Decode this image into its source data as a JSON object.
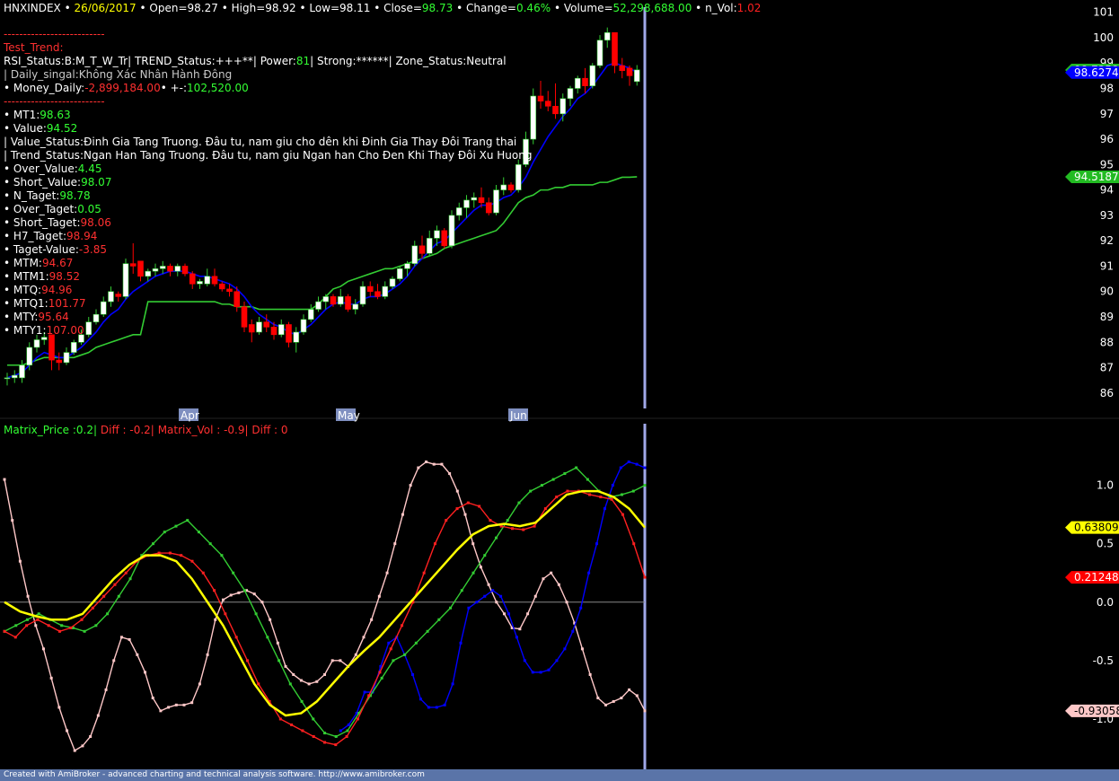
{
  "header": {
    "symbol": "HNXINDEX",
    "bullet": "•",
    "date": "26/06/2017",
    "open_label": "Open=",
    "open": "98.27",
    "high_label": "High=",
    "high": "98.92",
    "low_label": "Low=",
    "low": "98.11",
    "close_label": "Close=",
    "close": "98.73",
    "change_label": "Change=",
    "change": "0.46%",
    "volume_label": "Volume=",
    "volume": "52,298,688.00",
    "nvol_label": "n_Vol:",
    "nvol": "1.02"
  },
  "info": {
    "separator": "--------------------------",
    "test_trend": "Test_Trend:",
    "status_line": "RSI_Status:B:M_T_W_Tr| TREND_Status:+++**| Power:",
    "power": "81",
    "strong": "| Strong:******| Zone_Status:Neutral",
    "daily_signal": "| Daily_singal:Không Xác Nhân Hành Đông",
    "money_label": "• Money_Daily:",
    "money_value": "-2,899,184.00",
    "pm_label": "• +-:",
    "pm_value": "102,520.00",
    "mt1_label": "• MT1:",
    "mt1": "98.63",
    "value_label": "• Value:",
    "value": "94.52",
    "value_status": "| Value_Status:Đinh Gia Tang Truong. Đâu tu, nam giu cho dên khi Đinh Gia Thay Đôi Trang thai",
    "trend_status": "| Trend_Status:Ngan Han Tang Truong. Đâu tu, nam giu Ngan han Cho Đen Khi Thay Đôi Xu Huong",
    "over_value_label": "• Over_Value:",
    "over_value": "4.45",
    "short_value_label": "• Short_Value:",
    "short_value": "98.07",
    "n_taget_label": "• N_Taget:",
    "n_taget": "98.78",
    "over_taget_label": "• Over_Taget:",
    "over_taget": "0.05",
    "short_taget_label": "• Short_Taget:",
    "short_taget": "98.06",
    "h7_taget_label": "• H7_Taget:",
    "h7_taget": "98.94",
    "taget_value_label": "• Taget-Value:",
    "taget_value": "-3.85",
    "mtm_label": "• MTM:",
    "mtm": "94.67",
    "mtm1_label": "• MTM1:",
    "mtm1": "98.52",
    "mtq_label": "• MTQ:",
    "mtq": "94.96",
    "mtq1_label": "• MTQ1:",
    "mtq1": "101.77",
    "mty_label": "• MTY:",
    "mty": "95.64",
    "mty1_label": "• MTY1:",
    "mty1": "107.00"
  },
  "indicator": {
    "matrix_price": "Matrix_Price :0.2|",
    "diff1": "Diff : -0.2|",
    "matrix_vol": "Matrix_Vol : -0.9|",
    "diff2": "Diff : 0"
  },
  "footer": "Created with AmiBroker - advanced charting and technical analysis software. http://www.amibroker.com",
  "colors": {
    "up_candle": "#ffffff",
    "down_candle": "#ff0000",
    "green": "#33cc33",
    "blue": "#0000ff",
    "yellow": "#ffff00",
    "red": "#ff0000",
    "pink": "#ffc8c8",
    "cursor": "#a0a8e8",
    "month_tag": "#7f8fc0"
  },
  "chart_data": [
    {
      "type": "candlestick",
      "title": "HNXINDEX",
      "x_labels": [
        "Apr",
        "May",
        "Jun"
      ],
      "ylim": [
        85.5,
        101.2
      ],
      "y_ticks": [
        86,
        87,
        88,
        89,
        90,
        91,
        92,
        93,
        94,
        95,
        96,
        97,
        98,
        99,
        100,
        101
      ],
      "tags": [
        {
          "value": 98.7258,
          "label": "98.7258",
          "color": "#22bb22"
        },
        {
          "value": 98.6274,
          "label": "98.6274",
          "color": "#0000ff"
        },
        {
          "value": 94.5187,
          "label": "94.5187",
          "color": "#22bb22"
        }
      ],
      "ohlc": [
        [
          86.6,
          86.8,
          86.3,
          86.6
        ],
        [
          86.6,
          86.9,
          86.4,
          86.7
        ],
        [
          86.6,
          87.3,
          86.4,
          87.1
        ],
        [
          87.1,
          88.0,
          86.9,
          87.8
        ],
        [
          87.8,
          88.3,
          87.6,
          88.1
        ],
        [
          88.1,
          88.4,
          87.9,
          88.2
        ],
        [
          88.3,
          88.3,
          86.9,
          87.3
        ],
        [
          87.3,
          87.6,
          86.9,
          87.2
        ],
        [
          87.2,
          87.8,
          87.1,
          87.6
        ],
        [
          87.6,
          88.1,
          87.5,
          88.0
        ],
        [
          88.0,
          88.5,
          87.9,
          88.3
        ],
        [
          88.3,
          89.0,
          88.2,
          88.8
        ],
        [
          88.8,
          89.3,
          88.7,
          89.1
        ],
        [
          89.1,
          89.8,
          89.0,
          89.6
        ],
        [
          89.6,
          90.2,
          89.4,
          90.0
        ],
        [
          89.9,
          90.0,
          89.6,
          89.8
        ],
        [
          89.8,
          91.3,
          89.7,
          91.1
        ],
        [
          91.1,
          91.9,
          90.7,
          91.0
        ],
        [
          91.2,
          91.2,
          90.4,
          90.6
        ],
        [
          90.6,
          90.9,
          90.4,
          90.8
        ],
        [
          90.8,
          91.1,
          90.6,
          90.9
        ],
        [
          90.9,
          91.2,
          90.7,
          91.0
        ],
        [
          91.0,
          91.1,
          90.6,
          90.8
        ],
        [
          90.8,
          91.1,
          90.6,
          91.0
        ],
        [
          91.0,
          91.1,
          90.6,
          90.7
        ],
        [
          90.7,
          90.8,
          90.1,
          90.3
        ],
        [
          90.3,
          90.5,
          90.1,
          90.4
        ],
        [
          90.3,
          90.9,
          90.2,
          90.6
        ],
        [
          90.6,
          90.9,
          90.2,
          90.3
        ],
        [
          90.3,
          90.4,
          90.0,
          90.1
        ],
        [
          90.1,
          90.3,
          89.8,
          90.0
        ],
        [
          90.0,
          90.2,
          89.2,
          89.4
        ],
        [
          89.4,
          89.6,
          88.4,
          88.6
        ],
        [
          88.7,
          88.9,
          88.0,
          88.4
        ],
        [
          88.4,
          89.0,
          88.3,
          88.8
        ],
        [
          88.8,
          89.1,
          88.4,
          88.6
        ],
        [
          88.6,
          88.8,
          88.1,
          88.3
        ],
        [
          88.3,
          88.9,
          88.2,
          88.7
        ],
        [
          88.7,
          88.8,
          87.8,
          88.0
        ],
        [
          88.0,
          88.6,
          87.6,
          88.4
        ],
        [
          88.4,
          89.1,
          88.3,
          88.9
        ],
        [
          88.9,
          89.5,
          88.8,
          89.3
        ],
        [
          89.3,
          89.8,
          89.2,
          89.6
        ],
        [
          89.6,
          89.9,
          89.3,
          89.8
        ],
        [
          89.8,
          89.9,
          89.4,
          89.5
        ],
        [
          89.5,
          90.1,
          89.4,
          89.8
        ],
        [
          89.8,
          89.9,
          89.2,
          89.3
        ],
        [
          89.3,
          89.7,
          89.1,
          89.5
        ],
        [
          89.5,
          90.4,
          89.4,
          90.2
        ],
        [
          90.2,
          90.4,
          89.8,
          90.0
        ],
        [
          90.0,
          90.3,
          89.7,
          89.8
        ],
        [
          89.8,
          90.4,
          89.7,
          90.2
        ],
        [
          90.2,
          90.6,
          90.1,
          90.5
        ],
        [
          90.5,
          91.0,
          90.4,
          90.9
        ],
        [
          90.9,
          91.2,
          90.6,
          91.1
        ],
        [
          91.1,
          92.0,
          91.0,
          91.8
        ],
        [
          91.8,
          92.2,
          91.3,
          91.5
        ],
        [
          91.5,
          92.4,
          91.4,
          92.1
        ],
        [
          92.1,
          92.6,
          91.8,
          92.4
        ],
        [
          92.4,
          92.5,
          91.7,
          91.8
        ],
        [
          91.8,
          93.2,
          91.7,
          93.0
        ],
        [
          93.0,
          93.5,
          92.8,
          93.3
        ],
        [
          93.3,
          93.8,
          92.9,
          93.6
        ],
        [
          93.6,
          93.9,
          93.3,
          93.7
        ],
        [
          93.7,
          94.1,
          93.3,
          93.5
        ],
        [
          93.5,
          93.7,
          93.0,
          93.1
        ],
        [
          93.1,
          94.2,
          93.0,
          94.0
        ],
        [
          94.0,
          94.5,
          93.8,
          94.2
        ],
        [
          94.2,
          94.3,
          93.9,
          94.0
        ],
        [
          94.0,
          95.2,
          93.9,
          95.0
        ],
        [
          95.0,
          96.3,
          94.9,
          96.0
        ],
        [
          96.0,
          98.0,
          95.8,
          97.7
        ],
        [
          97.7,
          98.3,
          97.2,
          97.5
        ],
        [
          97.5,
          97.9,
          97.1,
          97.3
        ],
        [
          97.3,
          98.2,
          96.8,
          97.0
        ],
        [
          97.0,
          97.8,
          96.7,
          97.6
        ],
        [
          97.6,
          98.1,
          97.3,
          98.0
        ],
        [
          98.0,
          98.5,
          97.8,
          98.4
        ],
        [
          98.4,
          98.8,
          97.8,
          98.1
        ],
        [
          98.1,
          99.0,
          98.0,
          98.9
        ],
        [
          98.9,
          100.1,
          98.8,
          99.9
        ],
        [
          99.9,
          100.4,
          99.6,
          100.2
        ],
        [
          100.2,
          100.2,
          98.6,
          98.9
        ],
        [
          98.9,
          99.2,
          98.4,
          98.7
        ],
        [
          98.8,
          98.9,
          98.1,
          98.5
        ],
        [
          98.27,
          98.92,
          98.11,
          98.73
        ]
      ],
      "ma_blue": [
        86.6,
        86.7,
        86.8,
        87.1,
        87.4,
        87.6,
        87.5,
        87.4,
        87.4,
        87.6,
        87.8,
        88.1,
        88.4,
        88.8,
        89.1,
        89.3,
        89.7,
        90.0,
        90.2,
        90.4,
        90.6,
        90.7,
        90.8,
        90.8,
        90.8,
        90.7,
        90.6,
        90.6,
        90.5,
        90.4,
        90.3,
        90.1,
        89.8,
        89.4,
        89.1,
        88.9,
        88.7,
        88.6,
        88.4,
        88.3,
        88.5,
        88.7,
        89.0,
        89.3,
        89.5,
        89.6,
        89.5,
        89.5,
        89.7,
        89.8,
        89.8,
        89.9,
        90.1,
        90.3,
        90.6,
        91.0,
        91.3,
        91.6,
        91.9,
        92.0,
        92.3,
        92.6,
        92.9,
        93.2,
        93.4,
        93.4,
        93.5,
        93.7,
        93.8,
        94.1,
        94.5,
        95.1,
        95.6,
        96.1,
        96.5,
        96.9,
        97.2,
        97.6,
        97.8,
        98.1,
        98.5,
        98.9,
        99.0,
        98.9,
        98.8,
        98.63
      ],
      "ma_green": [
        87.1,
        87.1,
        87.1,
        87.2,
        87.3,
        87.4,
        87.4,
        87.4,
        87.4,
        87.4,
        87.5,
        87.6,
        87.8,
        87.9,
        88.0,
        88.1,
        88.2,
        88.3,
        88.3,
        89.6,
        89.6,
        89.6,
        89.6,
        89.6,
        89.6,
        89.6,
        89.6,
        89.6,
        89.6,
        89.5,
        89.5,
        89.4,
        89.4,
        89.4,
        89.3,
        89.3,
        89.3,
        89.3,
        89.3,
        89.3,
        89.3,
        89.3,
        89.5,
        89.8,
        90.1,
        90.2,
        90.4,
        90.5,
        90.6,
        90.7,
        90.8,
        90.9,
        90.9,
        91.0,
        91.1,
        91.2,
        91.3,
        91.4,
        91.5,
        91.7,
        91.8,
        91.9,
        92.0,
        92.1,
        92.2,
        92.3,
        92.4,
        92.7,
        93.1,
        93.5,
        93.7,
        93.8,
        94.0,
        94.0,
        94.1,
        94.1,
        94.2,
        94.2,
        94.2,
        94.2,
        94.3,
        94.3,
        94.4,
        94.5,
        94.5,
        94.52
      ]
    },
    {
      "type": "line",
      "ylim": [
        -1.3,
        1.35
      ],
      "y_ticks": [
        -1.0,
        -0.5,
        0.0,
        0.5,
        1.0
      ],
      "tags": [
        {
          "value": 0.638091,
          "label": "0.638091",
          "color": "#ffff00"
        },
        {
          "value": 0.212488,
          "label": "0.212488",
          "color": "#ff0000"
        },
        {
          "value": -0.930582,
          "label": "-0.930582",
          "color": "#ffc8c8"
        }
      ],
      "series": [
        {
          "color": "#ffc8c8",
          "values": [
            1.05,
            0.7,
            0.35,
            0.05,
            -0.2,
            -0.4,
            -0.65,
            -0.9,
            -1.1,
            -1.27,
            -1.23,
            -1.15,
            -0.97,
            -0.75,
            -0.5,
            -0.3,
            -0.32,
            -0.45,
            -0.6,
            -0.82,
            -0.93,
            -0.9,
            -0.88,
            -0.88,
            -0.86,
            -0.7,
            -0.45,
            -0.15,
            0.02,
            0.06,
            0.08,
            0.1,
            0.07,
            0.0,
            -0.15,
            -0.35,
            -0.55,
            -0.62,
            -0.67,
            -0.7,
            -0.68,
            -0.62,
            -0.5,
            -0.5,
            -0.55,
            -0.45,
            -0.3,
            -0.15,
            0.05,
            0.25,
            0.5,
            0.75,
            1.0,
            1.15,
            1.2,
            1.18,
            1.18,
            1.1,
            0.95,
            0.75,
            0.5,
            0.3,
            0.15,
            0.0,
            -0.1,
            -0.22,
            -0.23,
            -0.1,
            0.05,
            0.2,
            0.25,
            0.15,
            0.0,
            -0.18,
            -0.4,
            -0.62,
            -0.82,
            -0.88,
            -0.85,
            -0.82,
            -0.75,
            -0.8,
            -0.93
          ]
        },
        {
          "color": "#0000ff",
          "values": [
            null,
            null,
            null,
            null,
            null,
            null,
            null,
            null,
            null,
            null,
            null,
            null,
            null,
            null,
            null,
            null,
            null,
            null,
            null,
            null,
            null,
            null,
            null,
            null,
            null,
            null,
            null,
            null,
            null,
            null,
            null,
            null,
            null,
            null,
            null,
            null,
            null,
            null,
            null,
            null,
            null,
            null,
            -1.1,
            -1.05,
            -0.95,
            -0.77,
            -0.77,
            -0.55,
            -0.35,
            -0.3,
            -0.45,
            -0.62,
            -0.83,
            -0.9,
            -0.9,
            -0.88,
            -0.7,
            -0.35,
            -0.05,
            0.0,
            0.05,
            0.1,
            0.05,
            -0.1,
            -0.3,
            -0.5,
            -0.6,
            -0.6,
            -0.58,
            -0.5,
            -0.4,
            -0.25,
            -0.05,
            0.25,
            0.5,
            0.8,
            1.0,
            1.15,
            1.2,
            1.18,
            1.15
          ]
        },
        {
          "color": "#33cc33",
          "values": [
            -0.25,
            -0.2,
            -0.15,
            -0.1,
            -0.15,
            -0.2,
            -0.22,
            -0.25,
            -0.2,
            -0.1,
            0.05,
            0.2,
            0.4,
            0.5,
            0.6,
            0.65,
            0.7,
            0.6,
            0.5,
            0.4,
            0.25,
            0.1,
            -0.1,
            -0.3,
            -0.5,
            -0.7,
            -0.85,
            -1.0,
            -1.12,
            -1.15,
            -1.1,
            -0.95,
            -0.8,
            -0.65,
            -0.5,
            -0.45,
            -0.35,
            -0.25,
            -0.15,
            -0.05,
            0.1,
            0.25,
            0.4,
            0.55,
            0.7,
            0.85,
            0.95,
            1.0,
            1.05,
            1.1,
            1.15,
            1.05,
            0.95,
            0.9,
            0.92,
            0.95,
            1.0
          ]
        },
        {
          "color": "#ff2020",
          "values": [
            -0.25,
            -0.3,
            -0.2,
            -0.15,
            -0.2,
            -0.25,
            -0.22,
            -0.15,
            -0.05,
            0.05,
            0.15,
            0.25,
            0.35,
            0.4,
            0.42,
            0.42,
            0.4,
            0.35,
            0.25,
            0.1,
            -0.1,
            -0.3,
            -0.5,
            -0.7,
            -0.85,
            -1.0,
            -1.05,
            -1.1,
            -1.15,
            -1.2,
            -1.22,
            -1.15,
            -1.0,
            -0.8,
            -0.6,
            -0.4,
            -0.2,
            0.0,
            0.25,
            0.5,
            0.7,
            0.8,
            0.85,
            0.82,
            0.7,
            0.65,
            0.63,
            0.62,
            0.65,
            0.8,
            0.9,
            0.95,
            0.95,
            0.92,
            0.9,
            0.88,
            0.75,
            0.5,
            0.212488
          ]
        },
        {
          "color": "#ffff00",
          "smooth": true,
          "values": [
            0.0,
            -0.08,
            -0.12,
            -0.15,
            -0.15,
            -0.1,
            0.05,
            0.2,
            0.32,
            0.4,
            0.4,
            0.35,
            0.2,
            0.0,
            -0.2,
            -0.45,
            -0.7,
            -0.88,
            -0.97,
            -0.95,
            -0.85,
            -0.7,
            -0.55,
            -0.42,
            -0.3,
            -0.15,
            0.0,
            0.15,
            0.3,
            0.45,
            0.58,
            0.65,
            0.67,
            0.65,
            0.68,
            0.8,
            0.92,
            0.95,
            0.95,
            0.9,
            0.8,
            0.638091
          ]
        }
      ]
    }
  ]
}
